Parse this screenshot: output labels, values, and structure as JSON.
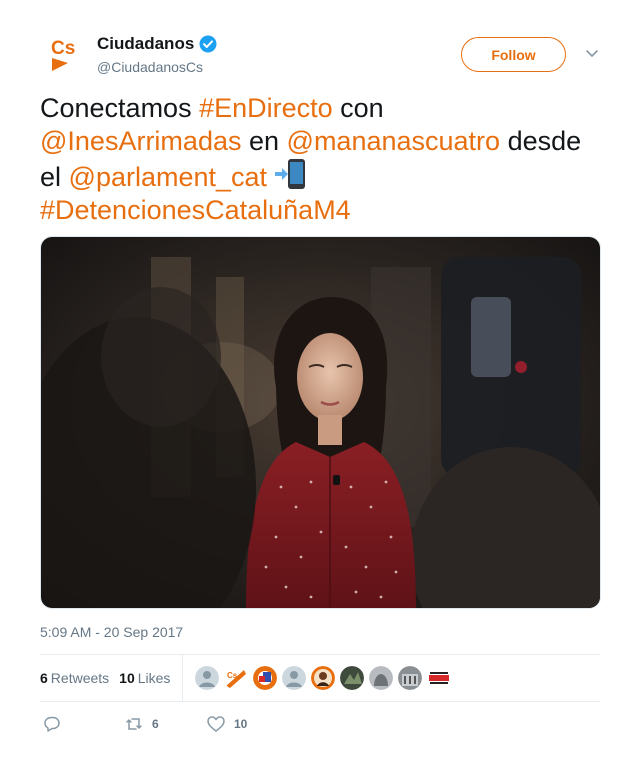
{
  "author": {
    "display_name": "Ciudadanos",
    "handle": "@CiudadanosCs",
    "avatar_logo": "Cs",
    "verified_icon": "verified-badge-icon",
    "brand_color": "#e86f10"
  },
  "follow_label": "Follow",
  "tweet": {
    "t1": "Conectamos ",
    "tag_endirecto": "#EnDirecto",
    "t2": " con ",
    "mention_ines": "@InesArrimadas",
    "t3": " en ",
    "mention_mananas": "@mananascuatro",
    "t4": " desde el ",
    "mention_parlament": "@parlament_cat",
    "emoji": "mobile-phone-arrow-emoji",
    "t5": " ",
    "tag_detenciones": "#DetencionesCataluñaM4"
  },
  "timestamp": "5:09 AM - 20 Sep 2017",
  "stats": {
    "retweets_count": "6",
    "retweets_label": "Retweets",
    "likes_count": "10",
    "likes_label": "Likes"
  },
  "actions": {
    "reply_icon": "reply-icon",
    "retweet_icon": "retweet-icon",
    "retweet_count": "6",
    "like_icon": "heart-icon",
    "like_count": "10"
  },
  "colors": {
    "link": "#e86f10",
    "secondary_text": "#657786",
    "divider": "#e6ecf0"
  }
}
